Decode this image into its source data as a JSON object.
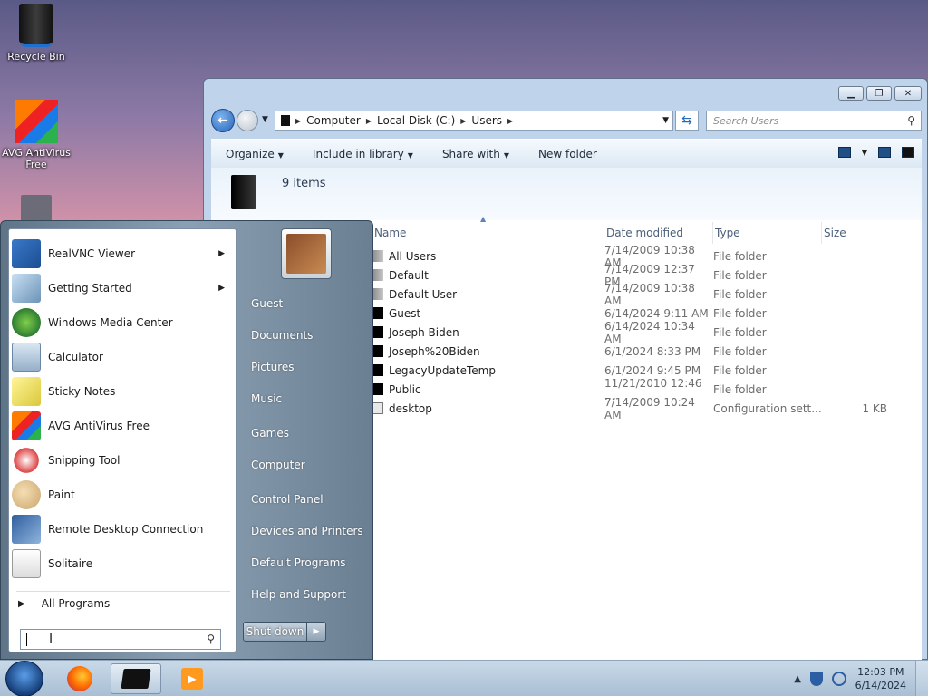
{
  "desktop": {
    "icons": [
      {
        "label": "Recycle Bin"
      },
      {
        "label": "AVG AntiVirus Free"
      }
    ]
  },
  "explorer": {
    "address": {
      "crumbs": [
        "Computer",
        "Local Disk (C:)",
        "Users"
      ]
    },
    "search_placeholder": "Search Users",
    "toolbar": {
      "organize": "Organize",
      "include": "Include in library",
      "share": "Share with",
      "new_folder": "New folder"
    },
    "item_count": "9 items",
    "columns": {
      "name": "Name",
      "date": "Date modified",
      "type": "Type",
      "size": "Size"
    },
    "rows": [
      {
        "name": "All Users",
        "date": "7/14/2009 10:38 AM",
        "type": "File folder",
        "size": ""
      },
      {
        "name": "Default",
        "date": "7/14/2009 12:37 PM",
        "type": "File folder",
        "size": ""
      },
      {
        "name": "Default User",
        "date": "7/14/2009 10:38 AM",
        "type": "File folder",
        "size": ""
      },
      {
        "name": "Guest",
        "date": "6/14/2024 9:11 AM",
        "type": "File folder",
        "size": ""
      },
      {
        "name": "Joseph Biden",
        "date": "6/14/2024 10:34 AM",
        "type": "File folder",
        "size": ""
      },
      {
        "name": "Joseph%20Biden",
        "date": "6/1/2024 8:33 PM",
        "type": "File folder",
        "size": ""
      },
      {
        "name": "LegacyUpdateTemp",
        "date": "6/1/2024 9:45 PM",
        "type": "File folder",
        "size": ""
      },
      {
        "name": "Public",
        "date": "11/21/2010 12:46 ...",
        "type": "File folder",
        "size": ""
      },
      {
        "name": "desktop",
        "date": "7/14/2009 10:24 AM",
        "type": "Configuration sett...",
        "size": "1 KB"
      }
    ]
  },
  "start_menu": {
    "programs": [
      {
        "label": "RealVNC Viewer",
        "arrow": true
      },
      {
        "label": "Getting Started",
        "arrow": true
      },
      {
        "label": "Windows Media Center",
        "arrow": false
      },
      {
        "label": "Calculator",
        "arrow": false
      },
      {
        "label": "Sticky Notes",
        "arrow": false
      },
      {
        "label": "AVG AntiVirus Free",
        "arrow": false
      },
      {
        "label": "Snipping Tool",
        "arrow": false
      },
      {
        "label": "Paint",
        "arrow": false
      },
      {
        "label": "Remote Desktop Connection",
        "arrow": false
      },
      {
        "label": "Solitaire",
        "arrow": false
      }
    ],
    "all_programs": "All Programs",
    "right_links": [
      "Guest",
      "Documents",
      "Pictures",
      "Music",
      "Games",
      "Computer",
      "Control Panel",
      "Devices and Printers",
      "Default Programs",
      "Help and Support"
    ],
    "shutdown": "Shut down"
  },
  "taskbar": {
    "time": "12:03 PM",
    "date": "6/14/2024"
  }
}
